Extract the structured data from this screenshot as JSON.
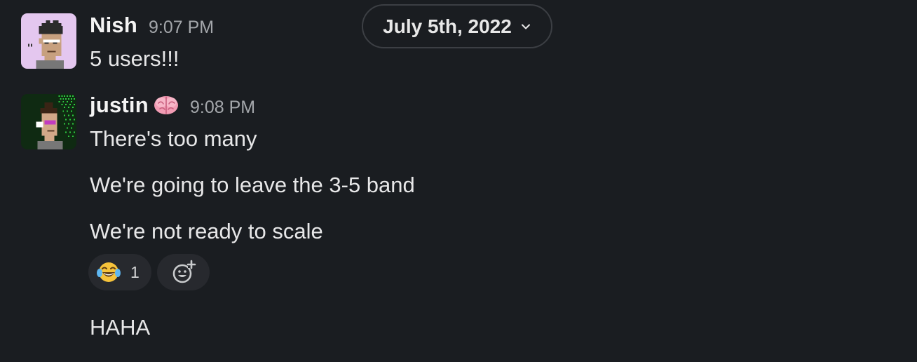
{
  "date_divider": {
    "label": "July 5th, 2022"
  },
  "messages": [
    {
      "author": "Nish",
      "time": "9:07 PM",
      "lines": [
        "5 users!!!"
      ]
    },
    {
      "author": "justin",
      "status_emoji": "brain",
      "time": "9:08 PM",
      "lines": [
        "There's too many",
        "We're going to leave the 3-5 band",
        "We're not ready to scale"
      ],
      "reactions": [
        {
          "emoji": "face-with-tears-of-joy",
          "count": "1"
        }
      ],
      "after_reactions": [
        "HAHA"
      ]
    }
  ],
  "icons": {
    "add_reaction": "add-reaction-icon",
    "chevron": "chevron-down-icon"
  },
  "colors": {
    "background": "#1a1d21",
    "text": "#e7e7e8",
    "muted": "#a4a7ab",
    "reaction_bg": "#27292e",
    "pill_border": "#3c3f44"
  }
}
